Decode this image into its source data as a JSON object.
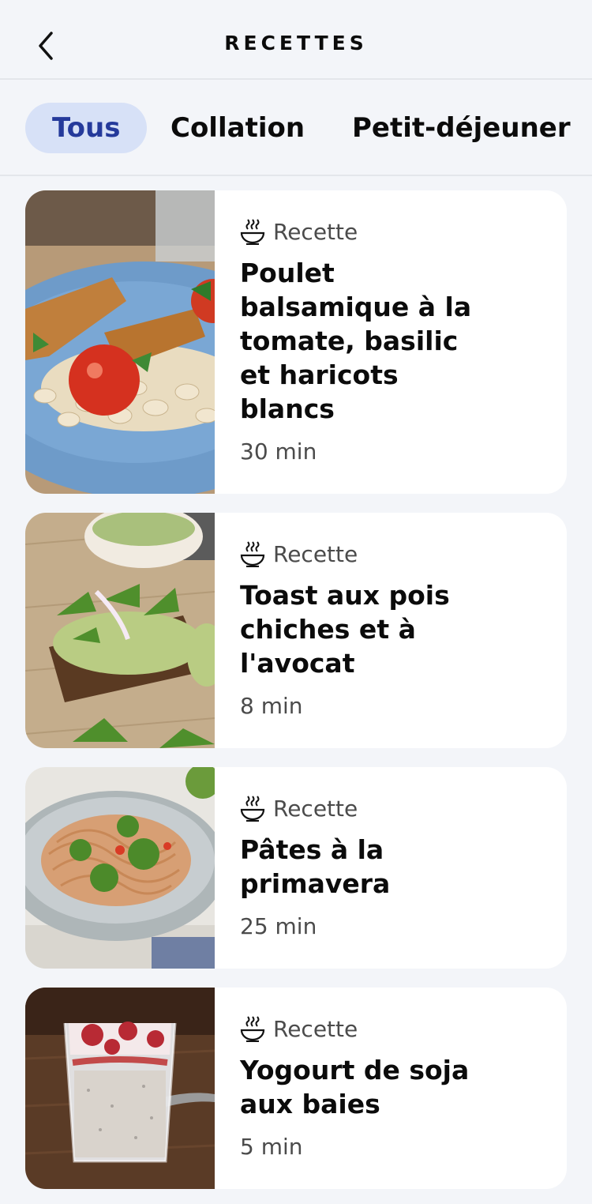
{
  "header": {
    "title": "RECETTES",
    "back_icon": "chevron-left-icon"
  },
  "tabs": [
    {
      "label": "Tous",
      "active": true
    },
    {
      "label": "Collation",
      "active": false
    },
    {
      "label": "Petit-déjeuner",
      "active": false
    }
  ],
  "colors": {
    "background": "#f3f5f9",
    "tab_active_bg": "#d7e1f7",
    "tab_active_text": "#253a9b",
    "card_bg": "#ffffff"
  },
  "recipes": [
    {
      "kind": "Recette",
      "kind_icon": "bowl-icon",
      "title": "Poulet balsamique à la tomate, basilic et haricots blancs",
      "duration": "30 min",
      "image": "chicken-beans-photo"
    },
    {
      "kind": "Recette",
      "kind_icon": "bowl-icon",
      "title": "Toast aux pois chiches et à l'avocat",
      "duration": "8 min",
      "image": "avocado-toast-photo"
    },
    {
      "kind": "Recette",
      "kind_icon": "bowl-icon",
      "title": "Pâtes à la primavera",
      "duration": "25 min",
      "image": "pasta-photo"
    },
    {
      "kind": "Recette",
      "kind_icon": "bowl-icon",
      "title": "Yogourt de soja aux baies",
      "duration": "5 min",
      "image": "yogurt-glass-photo"
    }
  ]
}
